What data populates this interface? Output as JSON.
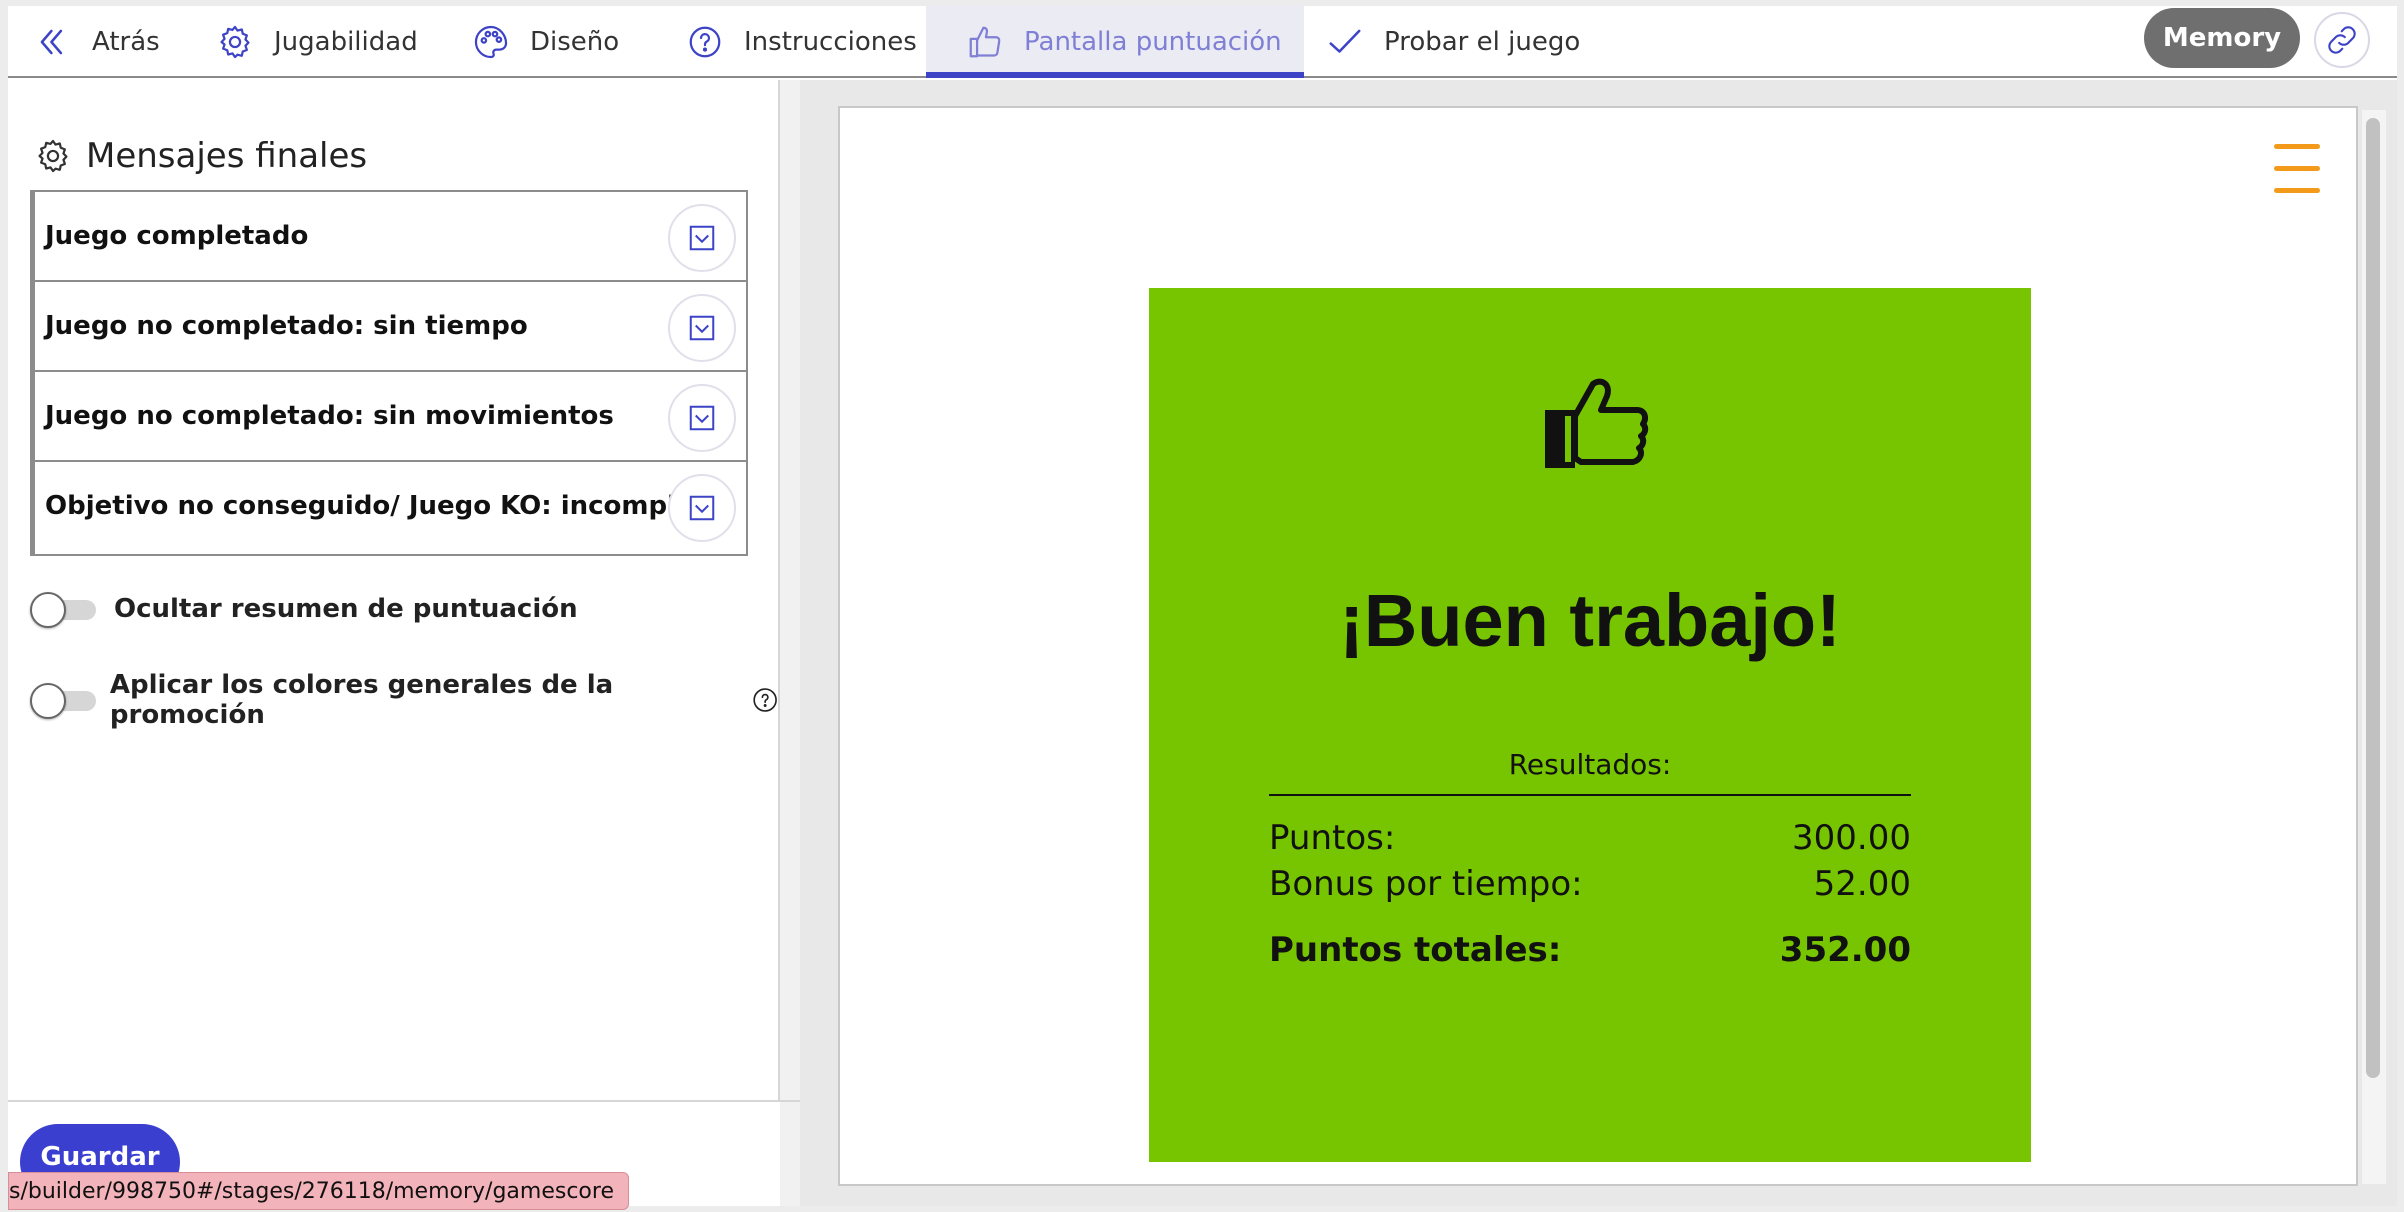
{
  "nav": {
    "back_label": "Atrás",
    "gameplay_label": "Jugabilidad",
    "design_label": "Diseño",
    "instructions_label": "Instrucciones",
    "score_screen_label": "Pantalla puntuación",
    "test_game_label": "Probar el juego",
    "game_type_label": "Memory"
  },
  "left_panel": {
    "section_title": "Mensajes finales",
    "messages": [
      {
        "label": "Juego completado"
      },
      {
        "label": "Juego no completado: sin tiempo"
      },
      {
        "label": "Juego no completado: sin movimientos"
      },
      {
        "label": "Objetivo no conseguido/ Juego KO: incompleto"
      }
    ],
    "toggles": [
      {
        "label": "Ocultar resumen de puntuación",
        "checked": false
      },
      {
        "label": "Aplicar los colores generales de la promoción",
        "checked": false
      }
    ],
    "save_label": "Guardar",
    "status_url": "s/builder/998750#/stages/276118/memory/gamescore"
  },
  "preview": {
    "title": "¡Buen trabajo!",
    "results_label": "Resultados:",
    "rows": [
      {
        "label": "Puntos:",
        "value": "300.00"
      },
      {
        "label": "Bonus por tiempo:",
        "value": "52.00"
      }
    ],
    "total": {
      "label": "Puntos totales:",
      "value": "352.00"
    },
    "card_color": "#77c500",
    "menu_color": "#f39a1b"
  },
  "colors": {
    "accent": "#3d43c7",
    "active_tab_text": "#7f7fd6"
  }
}
